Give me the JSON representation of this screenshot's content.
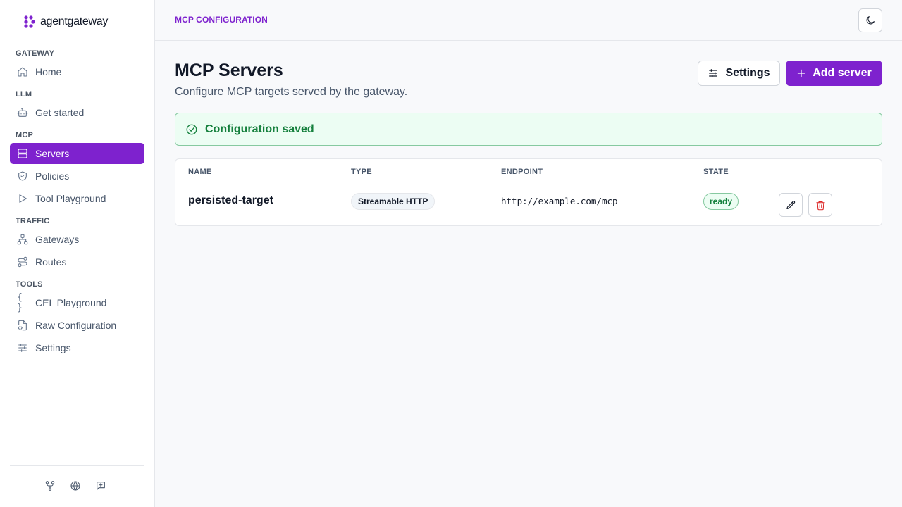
{
  "app": {
    "logo_text": "agentgateway",
    "breadcrumb": "MCP CONFIGURATION"
  },
  "sidebar": {
    "sections": [
      {
        "title": "GATEWAY",
        "items": [
          {
            "label": "Home",
            "icon": "home-icon"
          }
        ]
      },
      {
        "title": "LLM",
        "items": [
          {
            "label": "Get started",
            "icon": "bot-icon"
          }
        ]
      },
      {
        "title": "MCP",
        "items": [
          {
            "label": "Servers",
            "icon": "server-icon",
            "active": true
          },
          {
            "label": "Policies",
            "icon": "shield-check-icon"
          },
          {
            "label": "Tool Playground",
            "icon": "play-icon"
          }
        ]
      },
      {
        "title": "TRAFFIC",
        "items": [
          {
            "label": "Gateways",
            "icon": "network-icon"
          },
          {
            "label": "Routes",
            "icon": "route-icon"
          }
        ]
      },
      {
        "title": "TOOLS",
        "items": [
          {
            "label": "CEL Playground",
            "icon": "braces-icon"
          },
          {
            "label": "Raw Configuration",
            "icon": "file-code-icon"
          },
          {
            "label": "Settings",
            "icon": "sliders-icon"
          }
        ]
      }
    ],
    "footer_icons": [
      "git-fork-icon",
      "globe-icon",
      "message-plus-icon"
    ]
  },
  "header": {
    "theme_toggle_icon": "moon-icon"
  },
  "main": {
    "title": "MCP Servers",
    "subtitle": "Configure MCP targets served by the gateway.",
    "settings_button": "Settings",
    "add_button": "Add server",
    "alert": "Configuration saved",
    "table": {
      "columns": [
        "NAME",
        "TYPE",
        "ENDPOINT",
        "STATE"
      ],
      "rows": [
        {
          "name": "persisted-target",
          "type": "Streamable HTTP",
          "endpoint": "http://example.com/mcp",
          "state": "ready"
        }
      ]
    }
  },
  "colors": {
    "accent": "#7e22ce",
    "success": "#15803d",
    "danger": "#dc2626"
  }
}
